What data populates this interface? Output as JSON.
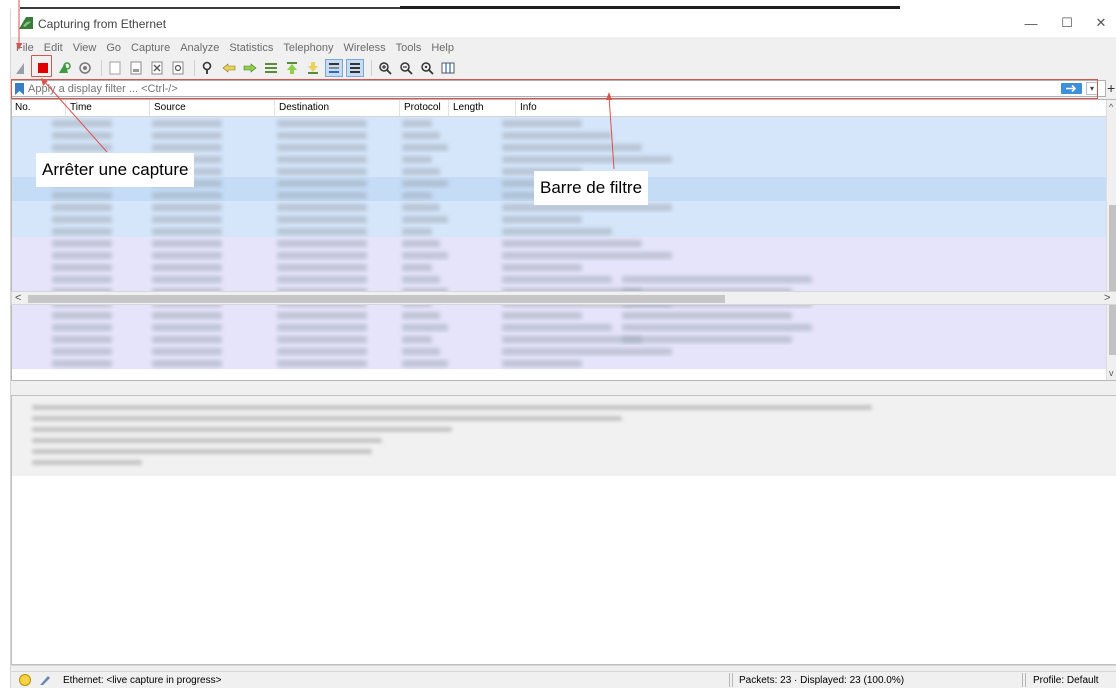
{
  "window": {
    "title": "Capturing from Ethernet",
    "controls": {
      "minimize": "—",
      "maximize": "☐",
      "close": "✕"
    }
  },
  "menu": [
    "File",
    "Edit",
    "View",
    "Go",
    "Capture",
    "Analyze",
    "Statistics",
    "Telephony",
    "Wireless",
    "Tools",
    "Help"
  ],
  "toolbar": {
    "icons": [
      "shark-fin-start-icon",
      "stop-capture-icon",
      "restart-capture-icon",
      "capture-options-icon",
      "open-file-icon",
      "save-file-icon",
      "close-file-icon",
      "reload-file-icon",
      "find-packet-icon",
      "go-back-icon",
      "go-forward-icon",
      "go-to-packet-icon",
      "go-first-icon",
      "go-last-icon",
      "autoscroll-icon",
      "colorize-icon",
      "zoom-in-icon",
      "zoom-out-icon",
      "zoom-normal-icon",
      "resize-columns-icon"
    ]
  },
  "filter": {
    "placeholder": "Apply a display filter ... <Ctrl-/>",
    "plus_label": "+",
    "dropdown_label": "▾"
  },
  "packet_list": {
    "columns": [
      "No.",
      "Time",
      "Source",
      "Destination",
      "Protocol",
      "Length",
      "Info"
    ],
    "row_count": 21,
    "scroll_up": "^",
    "scroll_down": "v",
    "scroll_left": "<",
    "scroll_right": ">"
  },
  "status": {
    "interface": "Ethernet: <live capture in progress>",
    "packets": "Packets: 23 · Displayed: 23 (100.0%)",
    "profile": "Profile: Default"
  },
  "annotations": {
    "stop_capture": "Arrêter une capture",
    "filter_bar": "Barre de filtre"
  },
  "colors": {
    "row_blue": "#d6e6fa",
    "row_blue_alt": "#c5dcf6",
    "row_purple": "#e6e4fa",
    "annotation_red": "#d9534f",
    "stop_red": "#e00000"
  }
}
